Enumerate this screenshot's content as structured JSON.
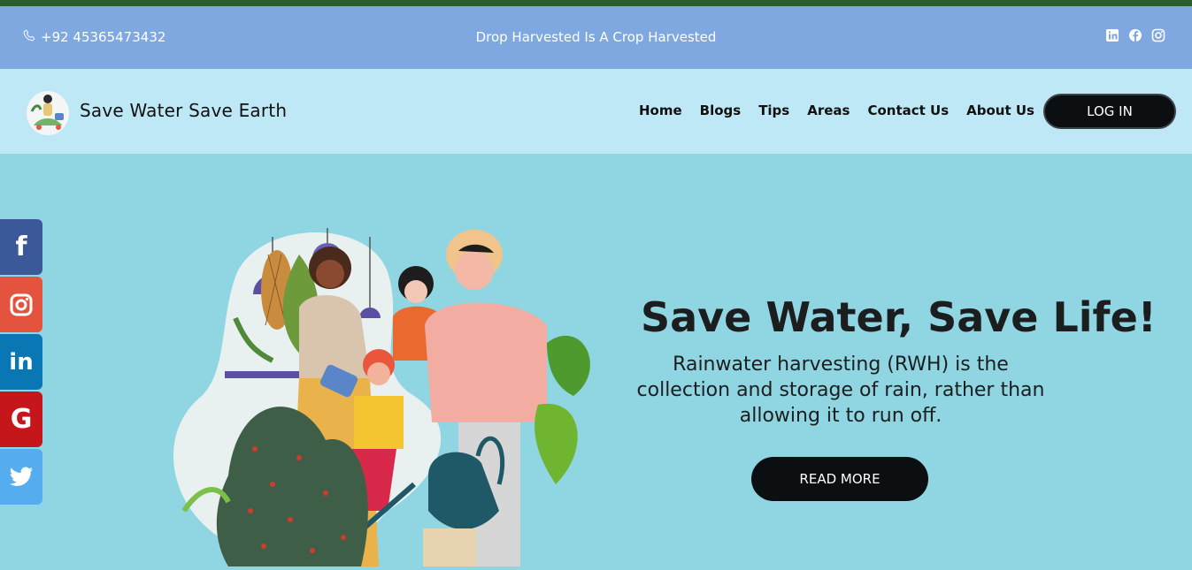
{
  "topbar": {
    "phone": "+92 45365473432",
    "tagline": "Drop Harvested Is A Crop Harvested",
    "social_icons": [
      "linkedin-icon",
      "facebook-icon",
      "instagram-icon"
    ]
  },
  "header": {
    "brand": "Save Water Save Earth",
    "nav": [
      "Home",
      "Blogs",
      "Tips",
      "Areas",
      "Contact Us",
      "About Us"
    ],
    "login": "LOG IN"
  },
  "hero": {
    "title": "Save Water, Save Life!",
    "text": "Rainwater harvesting (RWH) is the collection and storage of rain, rather than allowing it to run off.",
    "button": "READ MORE"
  },
  "side_social": [
    {
      "name": "facebook-icon",
      "glyph": "f",
      "color": "#3b5998"
    },
    {
      "name": "instagram-icon",
      "glyph": "",
      "color": "#e4533e"
    },
    {
      "name": "linkedin-icon",
      "glyph": "in",
      "color": "#0a77b5"
    },
    {
      "name": "google-icon",
      "glyph": "G",
      "color": "#c4161b"
    },
    {
      "name": "twitter-icon",
      "glyph": "",
      "color": "#55acee"
    }
  ],
  "colors": {
    "topline": "#2a5e30",
    "topbar": "#7fa8e0",
    "navbar": "#bfe8f6",
    "hero": "#8fd6e2",
    "button": "#0b0f12"
  }
}
